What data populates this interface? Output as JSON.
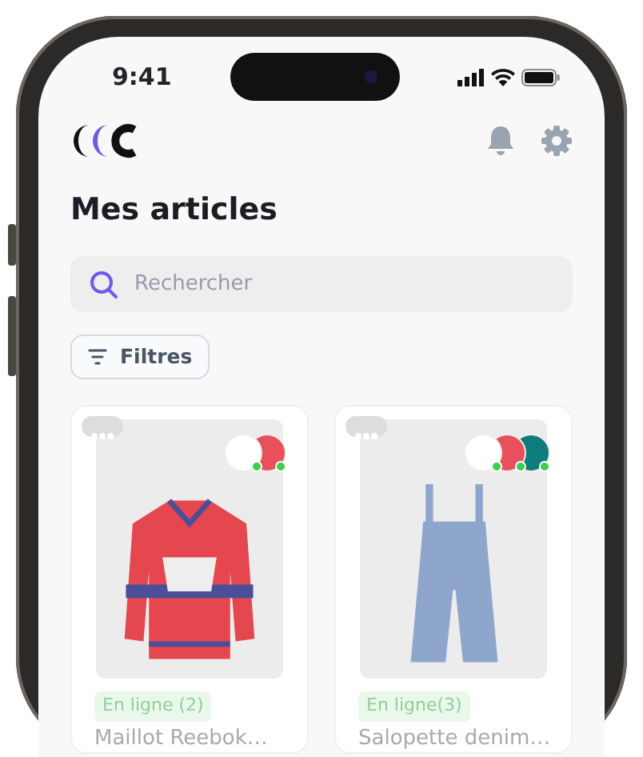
{
  "status_bar": {
    "time": "9:41"
  },
  "header": {
    "title": "Mes articles"
  },
  "search": {
    "placeholder": "Rechercher"
  },
  "filter_button": {
    "label": "Filtres"
  },
  "items": [
    {
      "kind": "jersey",
      "status": "En ligne (2)",
      "title": "Maillot Reebok…",
      "platforms": [
        {
          "color": "#ffffff",
          "online": true
        },
        {
          "color": "#e8505b",
          "online": true
        }
      ]
    },
    {
      "kind": "overalls",
      "status": "En ligne(3)",
      "title": "Salopette denim…",
      "platforms": [
        {
          "color": "#ffffff",
          "online": true
        },
        {
          "color": "#e8505b",
          "online": true
        },
        {
          "color": "#0f7c7c",
          "online": true
        }
      ]
    }
  ]
}
